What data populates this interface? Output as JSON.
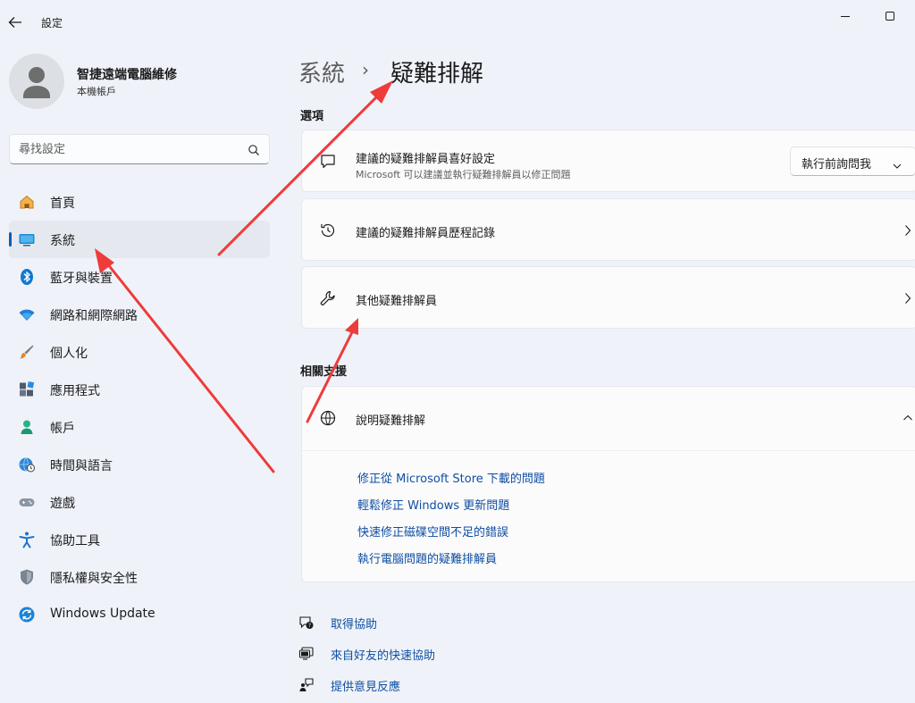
{
  "window": {
    "title": "設定",
    "controls": {
      "minimize_icon": "minimize-icon",
      "maximize_icon": "maximize-icon",
      "back_icon": "back-arrow-icon"
    }
  },
  "profile": {
    "name": "智捷遠端電腦維修",
    "account_type": "本機帳戶"
  },
  "search": {
    "placeholder": "尋找設定"
  },
  "sidebar": {
    "items": [
      {
        "label": "首頁",
        "icon": "home-icon"
      },
      {
        "label": "系統",
        "icon": "system-icon",
        "active": true
      },
      {
        "label": "藍牙與裝置",
        "icon": "bluetooth-icon"
      },
      {
        "label": "網路和網際網路",
        "icon": "wifi-icon"
      },
      {
        "label": "個人化",
        "icon": "brush-icon"
      },
      {
        "label": "應用程式",
        "icon": "apps-icon"
      },
      {
        "label": "帳戶",
        "icon": "account-icon"
      },
      {
        "label": "時間與語言",
        "icon": "globe-clock-icon"
      },
      {
        "label": "遊戲",
        "icon": "gamepad-icon"
      },
      {
        "label": "協助工具",
        "icon": "accessibility-icon"
      },
      {
        "label": "隱私權與安全性",
        "icon": "shield-icon"
      },
      {
        "label": "Windows Update",
        "icon": "update-icon"
      }
    ]
  },
  "breadcrumb": {
    "parent": "系統",
    "separator": "›",
    "current": "疑難排解"
  },
  "options": {
    "section_title": "選項",
    "recommended": {
      "title": "建議的疑難排解員喜好設定",
      "subtitle": "Microsoft 可以建議並執行疑難排解員以修正問題",
      "dropdown_value": "執行前詢問我"
    },
    "history": {
      "title": "建議的疑難排解員歷程記錄"
    },
    "other": {
      "title": "其他疑難排解員"
    }
  },
  "related": {
    "section_title": "相關支援",
    "help": {
      "title": "說明疑難排解",
      "links": [
        "修正從 Microsoft Store 下載的問題",
        "輕鬆修正 Windows 更新問題",
        "快速修正磁碟空間不足的錯誤",
        "執行電腦問題的疑難排解員"
      ]
    }
  },
  "footer_links": [
    {
      "label": "取得協助",
      "icon": "help-icon"
    },
    {
      "label": "來自好友的快速協助",
      "icon": "quick-assist-icon"
    },
    {
      "label": "提供意見反應",
      "icon": "feedback-icon"
    }
  ],
  "colors": {
    "accent": "#005fb8",
    "link": "#0f4ea1",
    "annotation_arrow": "#ee3b3b"
  }
}
